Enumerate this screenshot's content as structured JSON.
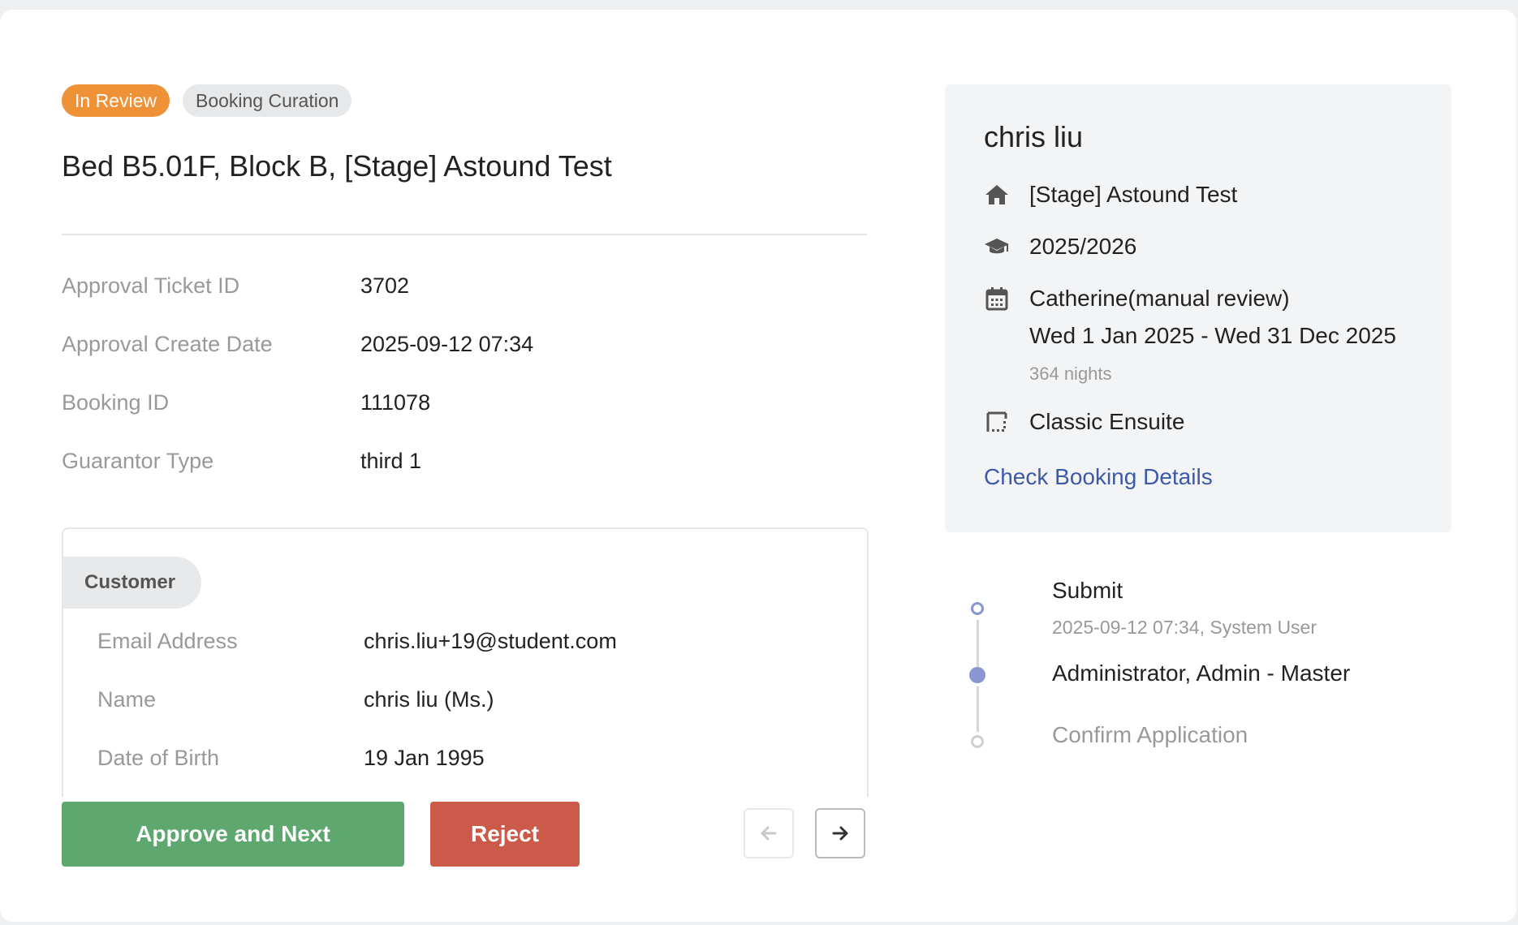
{
  "header": {
    "status_tag": "In Review",
    "category_tag": "Booking Curation",
    "title": "Bed B5.01F, Block B, [Stage] Astound Test"
  },
  "details": [
    {
      "label": "Approval Ticket ID",
      "value": "3702"
    },
    {
      "label": "Approval Create Date",
      "value": "2025-09-12 07:34"
    },
    {
      "label": "Booking ID",
      "value": "111078"
    },
    {
      "label": "Guarantor Type",
      "value": "third 1"
    }
  ],
  "customer": {
    "tab_label": "Customer",
    "fields": [
      {
        "label": "Email Address",
        "value": "chris.liu+19@student.com"
      },
      {
        "label": "Name",
        "value": "chris liu (Ms.)"
      },
      {
        "label": "Date of Birth",
        "value": "19 Jan 1995"
      }
    ]
  },
  "actions": {
    "approve_label": "Approve and Next",
    "reject_label": "Reject"
  },
  "sidebar": {
    "name": "chris liu",
    "property": "[Stage] Astound Test",
    "academic_year": "2025/2026",
    "tenancy_name": "Catherine(manual review)",
    "tenancy_dates": "Wed 1 Jan 2025 - Wed 31 Dec 2025",
    "nights": "364 nights",
    "room_type": "Classic Ensuite",
    "link_label": "Check Booking Details"
  },
  "timeline": [
    {
      "title": "Submit",
      "meta": "2025-09-12 07:34, System User",
      "state": "done"
    },
    {
      "title": "Administrator, Admin - Master",
      "meta": "",
      "state": "current"
    },
    {
      "title": "Confirm Application",
      "meta": "",
      "state": "pending"
    }
  ],
  "colors": {
    "status_tag": "#ef9136",
    "approve": "#5ea76e",
    "reject": "#cc5a4a",
    "link": "#3d59a8",
    "timeline_active": "#8a96d0"
  },
  "icons": {
    "property": "home-icon",
    "academic_year": "graduation-cap-icon",
    "tenancy": "calendar-icon",
    "room": "room-icon",
    "prev": "arrow-left-icon",
    "next": "arrow-right-icon"
  }
}
